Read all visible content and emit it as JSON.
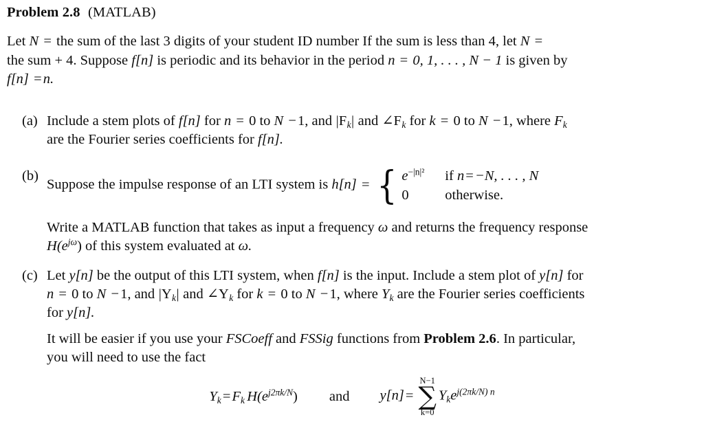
{
  "document": {
    "title_bold": "Problem 2.8",
    "title_rest": "(MATLAB)",
    "background_color": "#ffffff",
    "text_color": "#0d0d0d"
  },
  "intro": {
    "line1_a": "Let",
    "line1_var_N": "N",
    "line1_eq": "=",
    "line1_b": "the sum of the last 3 digits of your student ID number If the sum is less than 4, let",
    "line1_var_N2": "N",
    "line1_eq2": "=",
    "line2_a": "the sum + 4. Suppose",
    "line2_f": "f",
    "line2_fn": "[n]",
    "line2_b": "is periodic and its behavior in the period",
    "line2_n": "n",
    "line2_eq": "=",
    "line2_range": "0, 1, . . . , N − 1",
    "line2_c": "is given by",
    "line3_f": "f",
    "line3_fn": "[n]",
    "line3_eq": "=",
    "line3_n": "n."
  },
  "items": [
    {
      "marker": "(a)",
      "line1_a": "Include a stem plots of",
      "line1_f": "f",
      "line1_fbr": "[n]",
      "line1_b": "for",
      "line1_n": "n",
      "line1_eq": "=",
      "line1_c": "0 to",
      "line1_N": "N",
      "line1_minus": "−",
      "line1_one": "1, and",
      "line1_absF": "|F",
      "line1_absF_sub": "k",
      "line1_absF_end": "|",
      "line1_d": "and",
      "line1_angle": "∠F",
      "line1_angle_sub": "k",
      "line1_e": "for",
      "line1_k": "k",
      "line1_eq2": "=",
      "line1_f2": "0 to",
      "line1_N2": "N",
      "line1_minus2": "−",
      "line1_one2": "1, where",
      "line1_F": "F",
      "line1_F_sub": "k",
      "line2_a": "are the Fourier series coefficients for",
      "line2_f": "f",
      "line2_fbr": "[n]."
    },
    {
      "marker": "(b)",
      "line1_a": "Suppose the impulse response of an LTI system is",
      "line1_h": "h",
      "line1_hbr": "[n]",
      "line1_eq": "=",
      "case1_value_e": "e",
      "case1_value_exp": "−|n|²",
      "case1_cond_a": "if",
      "case1_cond_n": "n",
      "case1_cond_eq": "=",
      "case1_cond_range": "−N, . . . , N",
      "case2_value": "0",
      "case2_cond": "otherwise."
    },
    {
      "marker": "(c)",
      "line1_a": "Let",
      "line1_y": "y",
      "line1_ybr": "[n]",
      "line1_b": "be the output of this LTI system, when",
      "line1_f": "f",
      "line1_fbr": "[n]",
      "line1_c": "is the input. Include a stem plot of",
      "line1_y2": "y",
      "line1_ybr2": "[n]",
      "line1_d": "for",
      "line2_n": "n",
      "line2_eq": "=",
      "line2_a": "0 to",
      "line2_N": "N",
      "line2_minus": "−",
      "line2_one": "1, and",
      "line2_absY": "|Y",
      "line2_absY_sub": "k",
      "line2_absY_end": "|",
      "line2_b": "and",
      "line2_angle": "∠Y",
      "line2_angle_sub": "k",
      "line2_c": "for",
      "line2_k": "k",
      "line2_eq2": "=",
      "line2_d": "0 to",
      "line2_N2": "N",
      "line2_minus2": "−",
      "line2_one2": "1, where",
      "line2_Y": "Y",
      "line2_Y_sub": "k",
      "line2_e": "are the Fourier series coefficients",
      "line3_a": "for",
      "line3_y": "y",
      "line3_ybr": "[n]."
    }
  ],
  "paragraph_b2": {
    "line1_a": "Write a MATLAB function that takes as input a frequency",
    "line1_omega": "ω",
    "line1_b": "and returns the frequency response",
    "line2_H": "H",
    "line2_open": "(e",
    "line2_exp": "jω",
    "line2_close": ")",
    "line2_b": "of this system evaluated at",
    "line2_omega": "ω."
  },
  "paragraph_c2": {
    "line1_a": "It will be easier if you use your",
    "line1_fscoeff": "FSCoeff",
    "line1_b": "and",
    "line1_fssig": "FSSig",
    "line1_c": "functions from",
    "line1_problem": "Problem 2.6",
    "line1_d": ". In particular,",
    "line2": "you will need to use the fact"
  },
  "display_equation": {
    "lhs_Y": "Y",
    "lhs_Y_sub": "k",
    "lhs_eq": "=",
    "lhs_F": "F",
    "lhs_F_sub": "k",
    "lhs_H": "H",
    "lhs_open": "(e",
    "lhs_exp": "j2πk/N",
    "lhs_close": ")",
    "conjunction": "and",
    "rhs_y": "y",
    "rhs_ybr": "[n]",
    "rhs_eq": "=",
    "sum_glyph": "∑",
    "sum_upper": "N−1",
    "sum_lower": "k=0",
    "rhs_Y": "Y",
    "rhs_Y_sub": "k",
    "rhs_e": "e",
    "rhs_exp": "j(2πk/N) n"
  }
}
